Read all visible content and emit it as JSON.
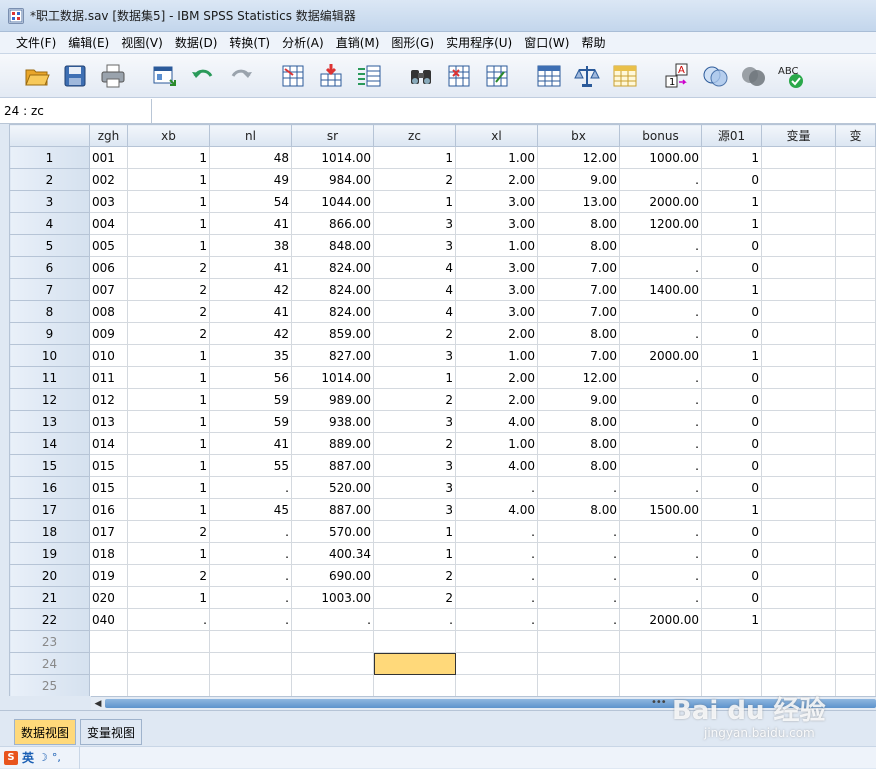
{
  "window": {
    "title": "*职工数据.sav [数据集5] - IBM SPSS Statistics 数据编辑器"
  },
  "menu": [
    "文件(F)",
    "编辑(E)",
    "视图(V)",
    "数据(D)",
    "转换(T)",
    "分析(A)",
    "直销(M)",
    "图形(G)",
    "实用程序(U)",
    "窗口(W)",
    "帮助"
  ],
  "toolbar": {
    "buttons": [
      "open-folder-icon",
      "save-icon",
      "print-icon",
      "dialog-recall-icon",
      "undo-icon",
      "redo-icon",
      "goto-case-icon",
      "goto-variable-icon",
      "variables-icon",
      "find-icon",
      "insert-cases-icon",
      "insert-variable-icon",
      "split-file-icon",
      "weight-cases-icon",
      "select-cases-icon",
      "value-labels-icon",
      "use-sets-icon",
      "show-all-variables-icon",
      "spell-check-icon"
    ],
    "value_labels_text": "A",
    "value_labels_num": "1",
    "spell_text": "ABC"
  },
  "cellref": {
    "label": "24 : zc"
  },
  "grid": {
    "columns": [
      "zgh",
      "xb",
      "nl",
      "sr",
      "zc",
      "xl",
      "bx",
      "bonus",
      "源01",
      "变量",
      "变"
    ],
    "rows": [
      [
        "1",
        "001",
        "1",
        "48",
        "1014.00",
        "1",
        "1.00",
        "12.00",
        "1000.00",
        "1"
      ],
      [
        "2",
        "002",
        "1",
        "49",
        "984.00",
        "2",
        "2.00",
        "9.00",
        ".",
        "0"
      ],
      [
        "3",
        "003",
        "1",
        "54",
        "1044.00",
        "1",
        "3.00",
        "13.00",
        "2000.00",
        "1"
      ],
      [
        "4",
        "004",
        "1",
        "41",
        "866.00",
        "3",
        "3.00",
        "8.00",
        "1200.00",
        "1"
      ],
      [
        "5",
        "005",
        "1",
        "38",
        "848.00",
        "3",
        "1.00",
        "8.00",
        ".",
        "0"
      ],
      [
        "6",
        "006",
        "2",
        "41",
        "824.00",
        "4",
        "3.00",
        "7.00",
        ".",
        "0"
      ],
      [
        "7",
        "007",
        "2",
        "42",
        "824.00",
        "4",
        "3.00",
        "7.00",
        "1400.00",
        "1"
      ],
      [
        "8",
        "008",
        "2",
        "41",
        "824.00",
        "4",
        "3.00",
        "7.00",
        ".",
        "0"
      ],
      [
        "9",
        "009",
        "2",
        "42",
        "859.00",
        "2",
        "2.00",
        "8.00",
        ".",
        "0"
      ],
      [
        "10",
        "010",
        "1",
        "35",
        "827.00",
        "3",
        "1.00",
        "7.00",
        "2000.00",
        "1"
      ],
      [
        "11",
        "011",
        "1",
        "56",
        "1014.00",
        "1",
        "2.00",
        "12.00",
        ".",
        "0"
      ],
      [
        "12",
        "012",
        "1",
        "59",
        "989.00",
        "2",
        "2.00",
        "9.00",
        ".",
        "0"
      ],
      [
        "13",
        "013",
        "1",
        "59",
        "938.00",
        "3",
        "4.00",
        "8.00",
        ".",
        "0"
      ],
      [
        "14",
        "014",
        "1",
        "41",
        "889.00",
        "2",
        "1.00",
        "8.00",
        ".",
        "0"
      ],
      [
        "15",
        "015",
        "1",
        "55",
        "887.00",
        "3",
        "4.00",
        "8.00",
        ".",
        "0"
      ],
      [
        "16",
        "015",
        "1",
        ".",
        "520.00",
        "3",
        ".",
        ".",
        ".",
        "0"
      ],
      [
        "17",
        "016",
        "1",
        "45",
        "887.00",
        "3",
        "4.00",
        "8.00",
        "1500.00",
        "1"
      ],
      [
        "18",
        "017",
        "2",
        ".",
        "570.00",
        "1",
        ".",
        ".",
        ".",
        "0"
      ],
      [
        "19",
        "018",
        "1",
        ".",
        "400.34",
        "1",
        ".",
        ".",
        ".",
        "0"
      ],
      [
        "20",
        "019",
        "2",
        ".",
        "690.00",
        "2",
        ".",
        ".",
        ".",
        "0"
      ],
      [
        "21",
        "020",
        "1",
        ".",
        "1003.00",
        "2",
        ".",
        ".",
        ".",
        "0"
      ],
      [
        "22",
        "040",
        ".",
        ".",
        ".",
        ".",
        ".",
        ".",
        "2000.00",
        "1"
      ]
    ],
    "empty_rows": [
      "23",
      "24",
      "25"
    ]
  },
  "tabs": {
    "data_view": "数据视图",
    "variable_view": "变量视图"
  },
  "ime": {
    "logo": "S",
    "lang": "英",
    "moon": "☽",
    "punct": "°,"
  },
  "watermark": {
    "logo": "Bai du 经验",
    "url": "jingyan.baidu.com"
  },
  "colors": {
    "selected_cell": "#ffd97a",
    "active_tab": "#ffd97a",
    "scroll_thumb": "#5d93cc"
  }
}
